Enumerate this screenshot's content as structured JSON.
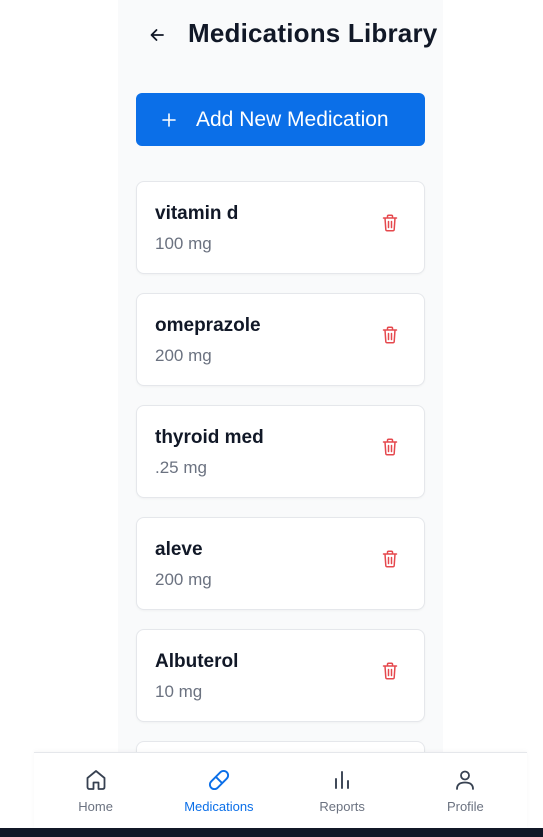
{
  "header": {
    "back_icon": "arrow-left-icon",
    "title": "Medications Library"
  },
  "add_button": {
    "icon": "plus-icon",
    "label": "Add New Medication"
  },
  "medications": [
    {
      "name": "vitamin d",
      "dose": "100 mg"
    },
    {
      "name": "omeprazole",
      "dose": "200 mg"
    },
    {
      "name": "thyroid med",
      "dose": ".25 mg"
    },
    {
      "name": "aleve",
      "dose": "200 mg"
    },
    {
      "name": "Albuterol",
      "dose": "10 mg"
    }
  ],
  "delete_icon": "trash-icon",
  "tabs": [
    {
      "label": "Home",
      "icon": "home-icon",
      "active": false
    },
    {
      "label": "Medications",
      "icon": "pill-icon",
      "active": true
    },
    {
      "label": "Reports",
      "icon": "bar-chart-icon",
      "active": false
    },
    {
      "label": "Profile",
      "icon": "user-icon",
      "active": false
    }
  ],
  "colors": {
    "accent": "#0b6fe8",
    "delete": "#e5484d",
    "text": "#111827",
    "muted": "#6b7280",
    "panel_bg": "#f9fafb"
  }
}
